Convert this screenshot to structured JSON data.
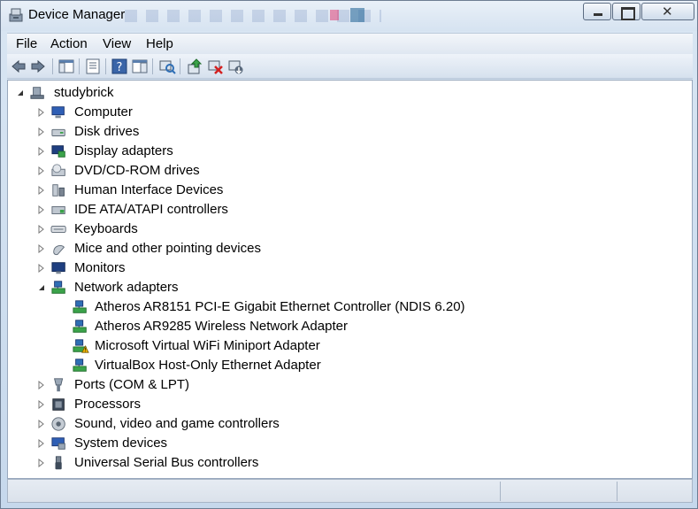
{
  "window": {
    "title": "Device Manager",
    "icon": "device-manager-icon"
  },
  "menu": [
    "File",
    "Action",
    "View",
    "Help"
  ],
  "toolbar": {
    "buttons": [
      "back-arrow-icon",
      "forward-arrow-icon",
      "show-hide-tree-icon",
      "properties-icon",
      "help-icon",
      "action-pane-icon",
      "scan-hardware-icon",
      "update-driver-icon",
      "uninstall-icon",
      "disable-icon"
    ]
  },
  "tree": {
    "root": {
      "label": "studybrick",
      "icon": "computer-tower-icon",
      "expanded": true
    },
    "items": [
      {
        "label": "Computer",
        "icon": "computer-icon",
        "expanded": false
      },
      {
        "label": "Disk drives",
        "icon": "disk-drive-icon",
        "expanded": false
      },
      {
        "label": "Display adapters",
        "icon": "display-adapter-icon",
        "expanded": false
      },
      {
        "label": "DVD/CD-ROM drives",
        "icon": "dvd-drive-icon",
        "expanded": false
      },
      {
        "label": "Human Interface Devices",
        "icon": "hid-icon",
        "expanded": false
      },
      {
        "label": "IDE ATA/ATAPI controllers",
        "icon": "ide-controller-icon",
        "expanded": false
      },
      {
        "label": "Keyboards",
        "icon": "keyboard-icon",
        "expanded": false
      },
      {
        "label": "Mice and other pointing devices",
        "icon": "mouse-icon",
        "expanded": false
      },
      {
        "label": "Monitors",
        "icon": "monitor-icon",
        "expanded": false
      },
      {
        "label": "Network adapters",
        "icon": "network-adapter-icon",
        "expanded": true,
        "children": [
          {
            "label": "Atheros AR8151 PCI-E Gigabit Ethernet Controller (NDIS 6.20)",
            "icon": "network-adapter-icon"
          },
          {
            "label": "Atheros AR9285 Wireless Network Adapter",
            "icon": "network-adapter-icon"
          },
          {
            "label": "Microsoft Virtual WiFi Miniport Adapter",
            "icon": "network-adapter-warning-icon"
          },
          {
            "label": "VirtualBox Host-Only Ethernet Adapter",
            "icon": "network-adapter-icon"
          }
        ]
      },
      {
        "label": "Ports (COM & LPT)",
        "icon": "port-icon",
        "expanded": false
      },
      {
        "label": "Processors",
        "icon": "processor-icon",
        "expanded": false
      },
      {
        "label": "Sound, video and game controllers",
        "icon": "sound-icon",
        "expanded": false
      },
      {
        "label": "System devices",
        "icon": "system-device-icon",
        "expanded": false
      },
      {
        "label": "Universal Serial Bus controllers",
        "icon": "usb-icon",
        "expanded": false
      }
    ]
  },
  "colors": {
    "accent": "#2f6fb5",
    "warning": "#f2b700"
  }
}
